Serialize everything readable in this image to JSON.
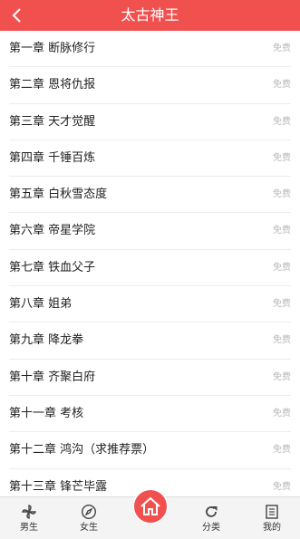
{
  "header": {
    "title": "太古神王"
  },
  "chapters": [
    {
      "title": "第一章 断脉修行",
      "tag": "免费"
    },
    {
      "title": "第二章 恩将仇报",
      "tag": "免费"
    },
    {
      "title": "第三章 天才觉醒",
      "tag": "免费"
    },
    {
      "title": "第四章 千锤百炼",
      "tag": "免费"
    },
    {
      "title": "第五章 白秋雪态度",
      "tag": "免费"
    },
    {
      "title": "第六章 帝星学院",
      "tag": "免费"
    },
    {
      "title": "第七章 铁血父子",
      "tag": "免费"
    },
    {
      "title": "第八章 姐弟",
      "tag": "免费"
    },
    {
      "title": "第九章 降龙拳",
      "tag": "免费"
    },
    {
      "title": "第十章 齐聚白府",
      "tag": "免费"
    },
    {
      "title": "第十一章 考核",
      "tag": "免费"
    },
    {
      "title": "第十二章 鸿沟（求推荐票）",
      "tag": "免费"
    },
    {
      "title": "第十三章 锋芒毕露",
      "tag": "免费"
    }
  ],
  "tabbar": {
    "male": "男生",
    "female": "女生",
    "category": "分类",
    "mine": "我的"
  },
  "colors": {
    "accent": "#f0514f"
  }
}
